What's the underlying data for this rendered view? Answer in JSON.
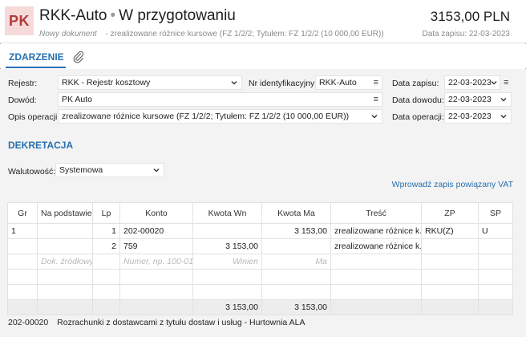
{
  "header": {
    "badge": "PK",
    "title": "RKK-Auto",
    "title_sep": "•",
    "status": "W przygotowaniu",
    "doc_type": "Nowy dokument",
    "doc_desc_prefix": "-",
    "doc_desc": "zrealizowane różnice kursowe (FZ 1/2/2; Tytułem: FZ 1/2/2 (10 000,00 EUR))",
    "amount": "3153,00 PLN",
    "date_label": "Data zapisu: 22-03-2023"
  },
  "tabs": {
    "zdarzenie": "ZDARZENIE",
    "attachment_icon": "paperclip-icon"
  },
  "form": {
    "rejestr_label": "Rejestr:",
    "rejestr_value": "RKK - Rejestr kosztowy",
    "dowod_label": "Dowód:",
    "dowod_value": "PK Auto",
    "opis_label": "Opis operacji:",
    "opis_value": "zrealizowane różnice kursowe (FZ 1/2/2; Tytułem: FZ 1/2/2 (10 000,00 EUR))",
    "nr_ident_label": "Nr identyfikacyjny:",
    "nr_ident_value": "RKK-Auto",
    "data_zapisu_label": "Data zapisu:",
    "data_zapisu_value": "22-03-2023",
    "data_dowodu_label": "Data dowodu:",
    "data_dowodu_value": "22-03-2023",
    "data_operacji_label": "Data operacji:",
    "data_operacji_value": "22-03-2023"
  },
  "dekretacja": {
    "title": "DEKRETACJA",
    "walutowosc_label": "Walutowość:",
    "walutowosc_value": "Systemowa",
    "vat_link": "Wprowadź zapis powiązany VAT"
  },
  "table": {
    "headers": [
      "Gr",
      "Na podstawie",
      "Lp",
      "Konto",
      "Kwota Wn",
      "Kwota Ma",
      "Treść",
      "ZP",
      "SP"
    ],
    "rows": [
      [
        "1",
        "",
        "1",
        "202-00020",
        "",
        "3 153,00",
        "zrealizowane różnice k...",
        "RKU(Z)",
        "U"
      ],
      [
        "",
        "",
        "2",
        "759",
        "3 153,00",
        "",
        "zrealizowane różnice k...",
        "",
        ""
      ]
    ],
    "placeholders": {
      "na_podstawie": "Dok. źródłowy",
      "konto": "Numer, np. 100-01",
      "kwota_wn": "Winien",
      "kwota_ma": "Ma"
    },
    "totals": {
      "wn": "3 153,00",
      "ma": "3 153,00"
    }
  },
  "footer": {
    "account": "202-00020",
    "description": "Rozrachunki z dostawcami z tytułu dostaw i usług - Hurtownia ALA"
  }
}
